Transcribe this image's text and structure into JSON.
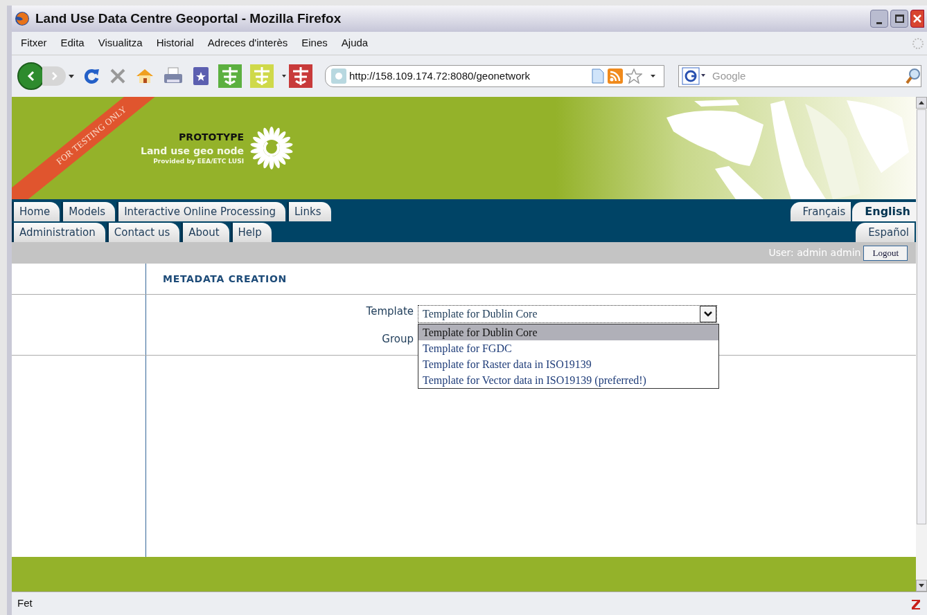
{
  "window": {
    "title": "Land Use Data Centre Geoportal - Mozilla Firefox"
  },
  "menu": [
    {
      "label": "Fitxer"
    },
    {
      "label": "Edita"
    },
    {
      "label": "Visualitza"
    },
    {
      "label": "Historial"
    },
    {
      "label": "Adreces d'interès"
    },
    {
      "label": "Eines"
    },
    {
      "label": "Ajuda"
    }
  ],
  "toolbar": {
    "url": "http://158.109.174.72:8080/geonetwork",
    "search_placeholder": "Google"
  },
  "banner": {
    "ribbon": "FOR TESTING ONLY",
    "title": "PROTOTYPE",
    "subtitle": "Land use geo node",
    "provider": "Provided by EEA/ETC LUSI"
  },
  "nav": {
    "rows": [
      {
        "tabs": [
          "Home",
          "Models",
          "Interactive Online Processing",
          "Links"
        ],
        "languages": [
          {
            "label": "Français",
            "selected": false
          },
          {
            "label": "English",
            "selected": true
          }
        ]
      },
      {
        "tabs": [
          "Administration",
          "Contact us",
          "About",
          "Help"
        ],
        "languages": [
          {
            "label": "Español",
            "selected": false
          }
        ]
      }
    ]
  },
  "user_bar": {
    "user": "User: admin admin",
    "logout": "Logout"
  },
  "heading": "METADATA CREATION",
  "form": {
    "template_label": "Template",
    "template_value": "Template for Dublin Core",
    "group_label": "Group",
    "options": [
      {
        "label": "Template for Dublin Core",
        "selected": true
      },
      {
        "label": "Template for FGDC",
        "selected": false
      },
      {
        "label": "Template for Raster data in ISO19139",
        "selected": false
      },
      {
        "label": "Template for Vector data in ISO19139 (preferred!)",
        "selected": false
      }
    ]
  },
  "status_bar": {
    "text": "Fet"
  }
}
